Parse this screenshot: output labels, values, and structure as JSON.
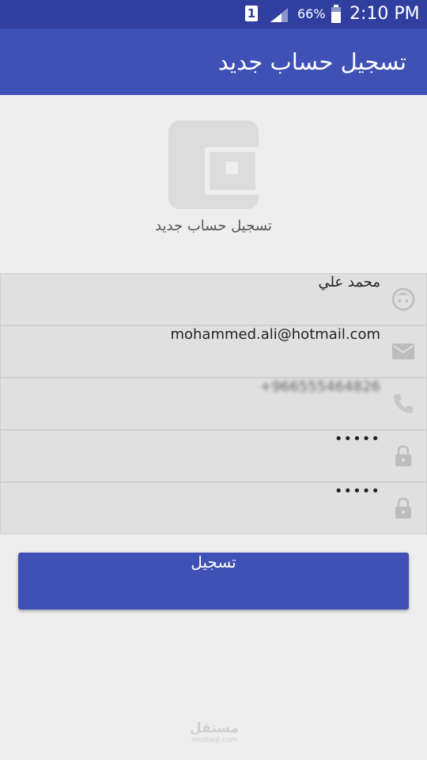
{
  "status_bar": {
    "sim_slot": "1",
    "battery": "66%",
    "time": "2:10 PM"
  },
  "app_bar": {
    "title": "تسجيل حساب جديد"
  },
  "header": {
    "subtitle": "تسجيل حساب جديد"
  },
  "form": {
    "name": "محمد علي",
    "email": "mohammed.ali@hotmail.com",
    "phone": "+966555464826",
    "password": "•••••",
    "confirm_password": "•••••"
  },
  "register_button": {
    "label": "تسجيل"
  },
  "watermark": {
    "arabic": "مستقل",
    "latin": "mostaql.com"
  }
}
